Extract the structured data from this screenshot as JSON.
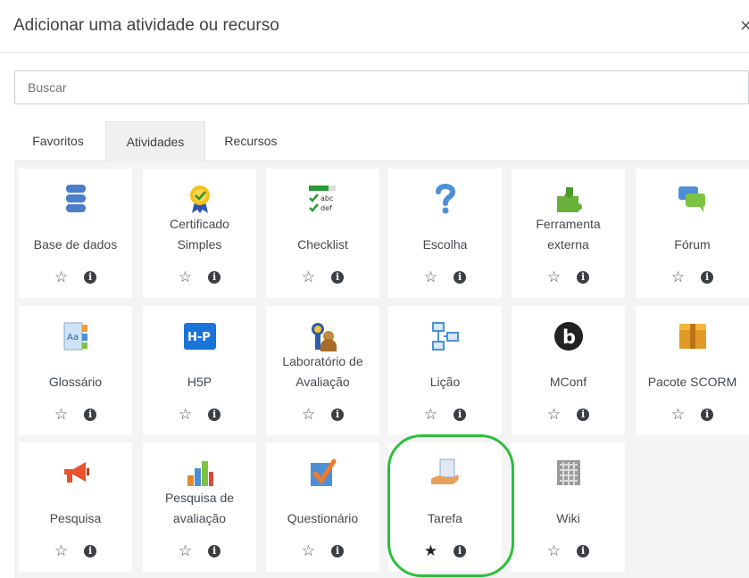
{
  "modal": {
    "title": "Adicionar uma atividade ou recurso",
    "close_label": "×"
  },
  "search": {
    "placeholder": "Buscar",
    "value": ""
  },
  "tabs": [
    {
      "label": "Favoritos",
      "active": false
    },
    {
      "label": "Atividades",
      "active": true
    },
    {
      "label": "Recursos",
      "active": false
    }
  ],
  "items": [
    {
      "name": "Base de dados",
      "icon": "database-icon",
      "starred": false
    },
    {
      "name": "Certificado Simples",
      "icon": "certificate-icon",
      "starred": false
    },
    {
      "name": "Checklist",
      "icon": "checklist-icon",
      "starred": false
    },
    {
      "name": "Escolha",
      "icon": "question-icon",
      "starred": false
    },
    {
      "name": "Ferramenta externa",
      "icon": "puzzle-icon",
      "starred": false
    },
    {
      "name": "Fórum",
      "icon": "forum-icon",
      "starred": false
    },
    {
      "name": "Glossário",
      "icon": "glossary-icon",
      "starred": false
    },
    {
      "name": "H5P",
      "icon": "h5p-icon",
      "starred": false,
      "icon_text": "H-P"
    },
    {
      "name": "Laboratório de Avaliação",
      "icon": "workshop-icon",
      "starred": false
    },
    {
      "name": "Lição",
      "icon": "lesson-icon",
      "starred": false
    },
    {
      "name": "MConf",
      "icon": "mconf-icon",
      "starred": false,
      "icon_text": "b"
    },
    {
      "name": "Pacote SCORM",
      "icon": "scorm-icon",
      "starred": false
    },
    {
      "name": "Pesquisa",
      "icon": "megaphone-icon",
      "starred": false
    },
    {
      "name": "Pesquisa de avaliação",
      "icon": "bar-chart-icon",
      "starred": false
    },
    {
      "name": "Questionário",
      "icon": "quiz-icon",
      "starred": false
    },
    {
      "name": "Tarefa",
      "icon": "assignment-icon",
      "starred": true
    },
    {
      "name": "Wiki",
      "icon": "wiki-icon",
      "starred": false
    }
  ],
  "glyphs": {
    "star_empty": "☆",
    "star_filled": "★",
    "info": "i"
  },
  "colors": {
    "highlight": "#2dbf3b",
    "grid_bg": "#f4f4f4",
    "h5p_blue": "#1a73d9"
  }
}
